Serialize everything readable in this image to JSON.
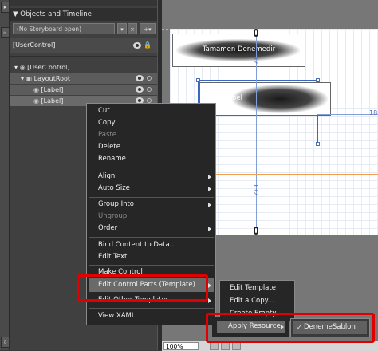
{
  "panel": {
    "title": "Objects and Timeline",
    "storyboard_placeholder": "(No Storyboard open)",
    "root": "[UserControl]",
    "tree": [
      "[UserControl]",
      "LayoutRoot",
      "[Label]",
      "[Label]"
    ]
  },
  "artboard": {
    "button1_text": "Tamamen Denemedir",
    "button2_text": "Label",
    "measure_width": "18",
    "measure_height": "132",
    "measure_top": "32"
  },
  "context_menu": {
    "items": [
      "Cut",
      "Copy",
      "Paste",
      "Delete",
      "Rename",
      "Align",
      "Auto Size",
      "Group Into",
      "Ungroup",
      "Order",
      "Bind Content to Data...",
      "Edit Text",
      "Make Control",
      "Edit Control Parts (Template)",
      "Edit Other Templates",
      "View XAML"
    ]
  },
  "submenu": {
    "items": [
      "Edit Template",
      "Edit a Copy...",
      "Create Empty...",
      "Apply Resource"
    ]
  },
  "submenu2": {
    "items": [
      "DenemeSablon"
    ]
  },
  "zoom": "100%"
}
